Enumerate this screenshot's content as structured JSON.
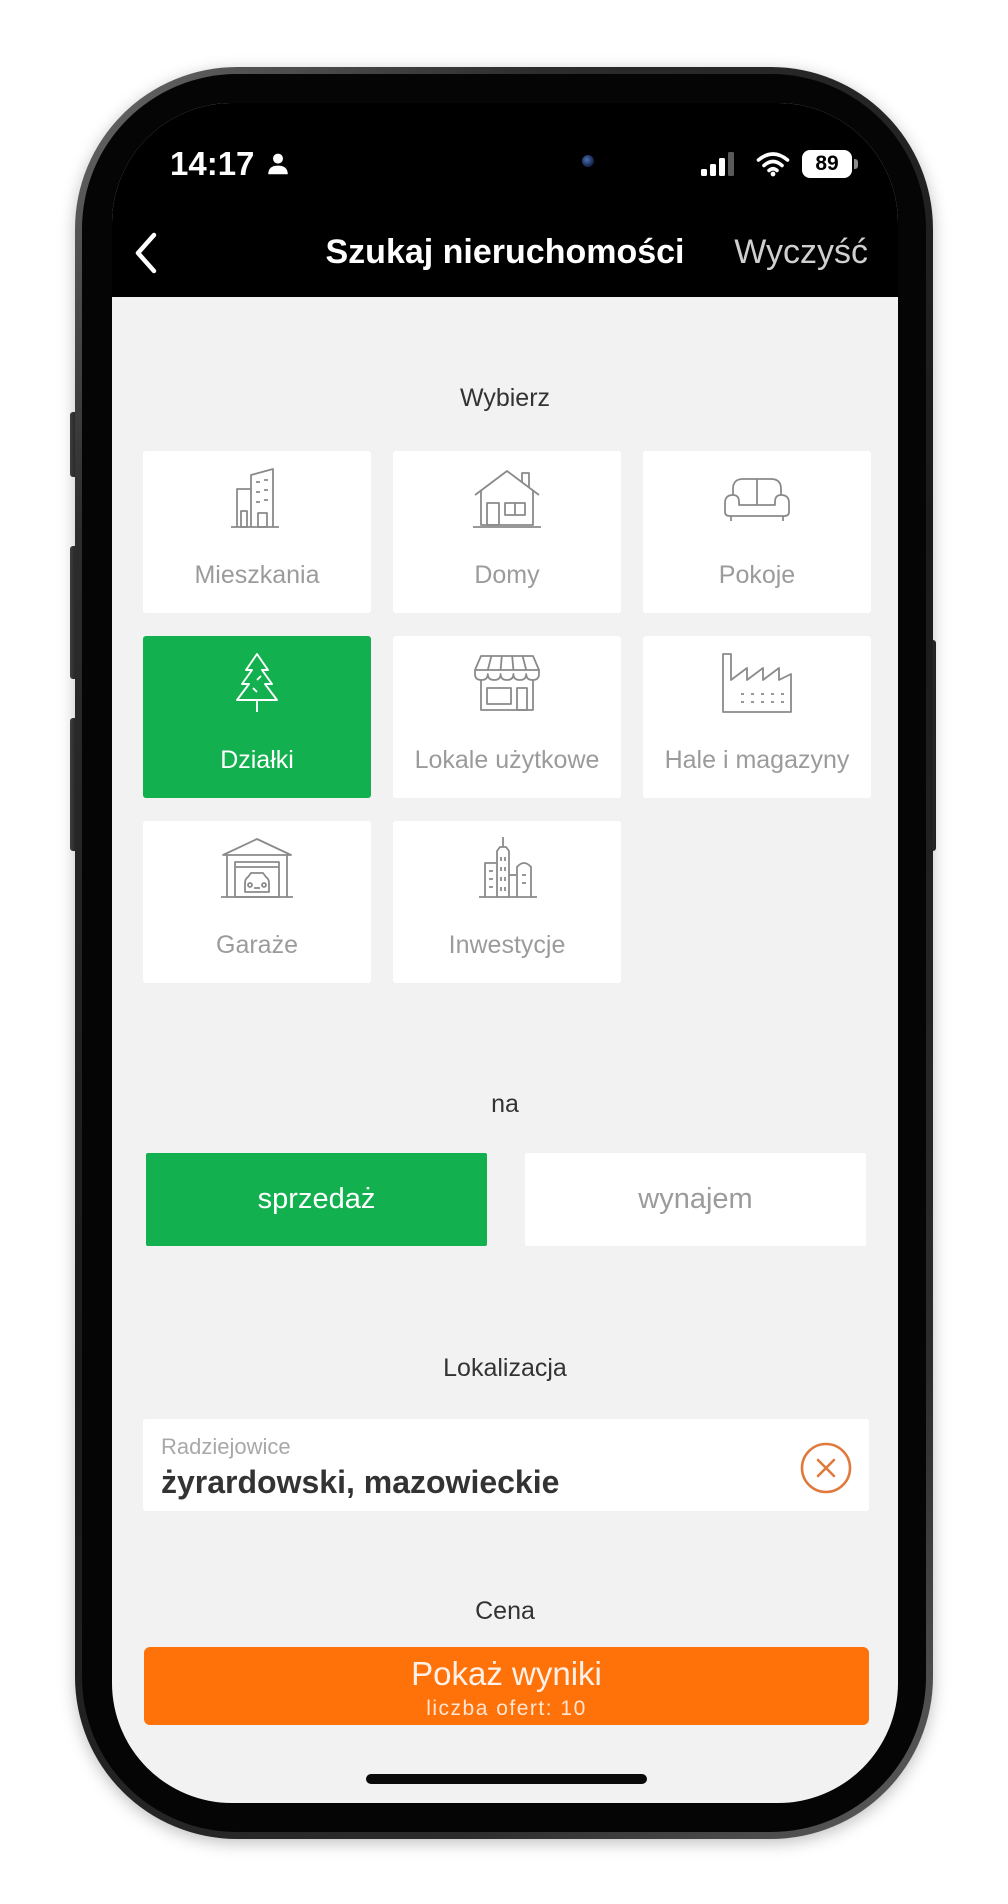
{
  "status_bar": {
    "time": "14:17",
    "battery_level": "89",
    "icons": [
      "person-icon",
      "signal-icon",
      "wifi-icon",
      "battery-icon"
    ]
  },
  "nav": {
    "back_icon": "chevron-left-icon",
    "title": "Szukaj nieruchomości",
    "clear_label": "Wyczyść"
  },
  "property_type": {
    "heading": "Wybierz",
    "options": [
      {
        "label": "Mieszkania",
        "icon": "building-icon",
        "selected": false
      },
      {
        "label": "Domy",
        "icon": "house-icon",
        "selected": false
      },
      {
        "label": "Pokoje",
        "icon": "sofa-icon",
        "selected": false
      },
      {
        "label": "Działki",
        "icon": "tree-icon",
        "selected": true
      },
      {
        "label": "Lokale użytkowe",
        "icon": "shop-icon",
        "selected": false
      },
      {
        "label": "Hale i magazyny",
        "icon": "factory-icon",
        "selected": false
      },
      {
        "label": "Garaże",
        "icon": "garage-icon",
        "selected": false
      },
      {
        "label": "Inwestycje",
        "icon": "city-icon",
        "selected": false
      }
    ]
  },
  "transaction": {
    "heading": "na",
    "options": [
      {
        "label": "sprzedaż",
        "selected": true
      },
      {
        "label": "wynajem",
        "selected": false
      }
    ]
  },
  "location": {
    "heading": "Lokalizacja",
    "place": "Radziejowice",
    "region": "żyrardowski, mazowieckie",
    "clear_icon": "close-circle-icon"
  },
  "price": {
    "heading": "Cena"
  },
  "results_button": {
    "label": "Pokaż wyniki",
    "count_text": "liczba ofert: 10"
  },
  "colors": {
    "selected_green": "#12b04e",
    "action_orange": "#ff720a",
    "clear_icon_orange": "#e07a3c",
    "header_black": "#000000",
    "content_background": "#f2f2f2"
  }
}
